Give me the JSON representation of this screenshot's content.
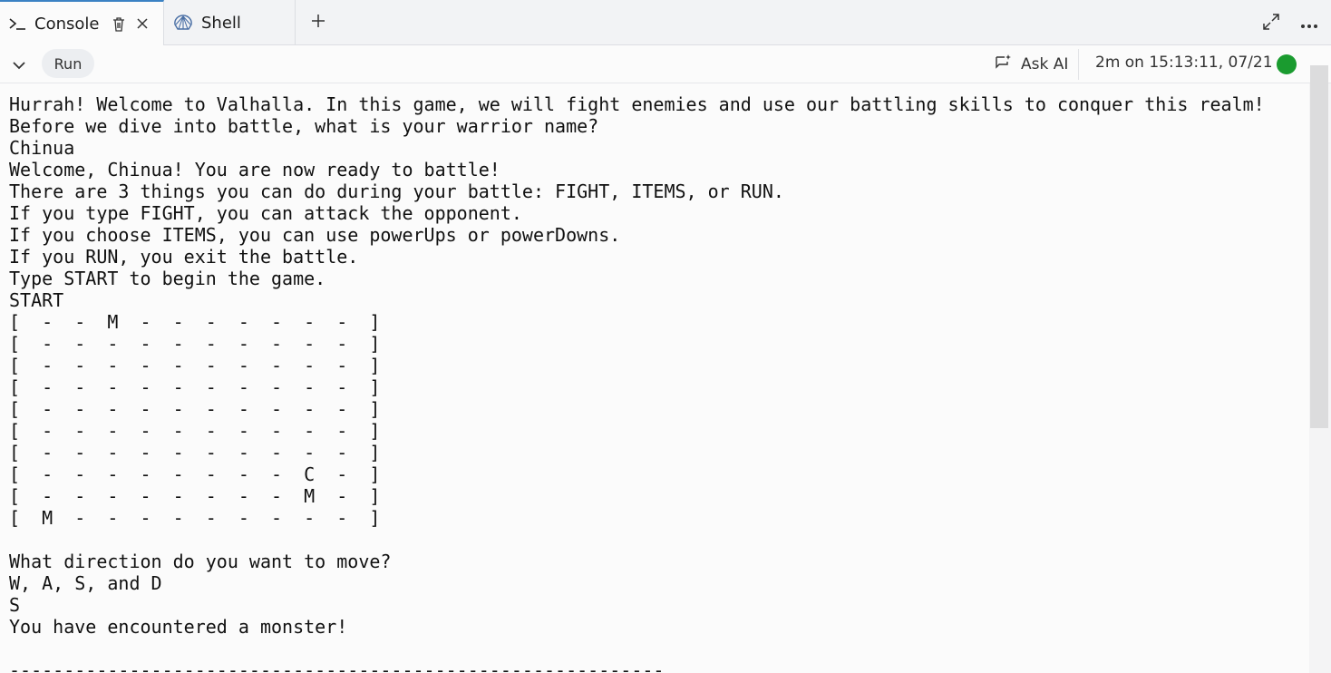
{
  "tabs": {
    "console": {
      "label": "Console"
    },
    "shell": {
      "label": "Shell"
    }
  },
  "toolbar": {
    "run_label": "Run",
    "ask_ai_label": "Ask AI",
    "status_text": "2m on 15:13:11, 07/21",
    "status_color": "#1a9b2f"
  },
  "icons": {
    "console_tab": "terminal-prompt-icon",
    "trash": "trash-icon",
    "close": "close-icon",
    "shell_tab": "shell-icon",
    "add_tab": "plus-icon",
    "expand": "expand-icon",
    "more": "more-icon",
    "collapse": "chevron-down-icon",
    "ask_ai": "ask-ai-icon"
  },
  "console": {
    "lines": [
      "Hurrah! Welcome to Valhalla. In this game, we will fight enemies and use our battling skills to conquer this realm!",
      "Before we dive into battle, what is your warrior name?",
      "Chinua",
      "Welcome, Chinua! You are now ready to battle!",
      "There are 3 things you can do during your battle: FIGHT, ITEMS, or RUN.",
      "If you type FIGHT, you can attack the opponent.",
      "If you choose ITEMS, you can use powerUps or powerDowns.",
      "If you RUN, you exit the battle.",
      "Type START to begin the game.",
      "START",
      "[  -  -  M  -  -  -  -  -  -  -  ]",
      "[  -  -  -  -  -  -  -  -  -  -  ]",
      "[  -  -  -  -  -  -  -  -  -  -  ]",
      "[  -  -  -  -  -  -  -  -  -  -  ]",
      "[  -  -  -  -  -  -  -  -  -  -  ]",
      "[  -  -  -  -  -  -  -  -  -  -  ]",
      "[  -  -  -  -  -  -  -  -  -  -  ]",
      "[  -  -  -  -  -  -  -  -  C  -  ]",
      "[  -  -  -  -  -  -  -  -  M  -  ]",
      "[  M  -  -  -  -  -  -  -  -  -  ]",
      "",
      "What direction do you want to move?",
      "W, A, S, and D",
      "S",
      "You have encountered a monster!",
      "",
      "------------------------------------------------------------"
    ]
  }
}
